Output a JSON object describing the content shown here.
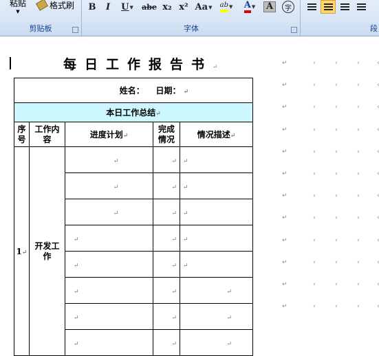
{
  "ribbon": {
    "clipboard": {
      "paste_label": "粘贴",
      "format_painter_label": "格式刷",
      "group_label": "剪贴板"
    },
    "font": {
      "bold": "B",
      "italic": "I",
      "underline": "U",
      "strikethrough": "abe",
      "subscript": "x₂",
      "superscript": "x²",
      "change_case": "Aa",
      "highlight": "ab",
      "font_color": "A",
      "char_shading": "A",
      "enclose": "字",
      "group_label": "字体"
    },
    "paragraph": {
      "group_label": "段"
    },
    "colors": {
      "highlight": "#ffff00",
      "font_color": "#e00000"
    }
  },
  "document": {
    "title": "每日工作报告书",
    "paragraph_mark": "↵",
    "table": {
      "name_date_row": "姓名：    日期：",
      "summary_header": "本日工作总结",
      "headers": [
        "序号",
        "工作内容",
        "进度计划",
        "完成情况",
        "情况描述"
      ],
      "row_number": "1",
      "work_content": "开发工作"
    }
  }
}
